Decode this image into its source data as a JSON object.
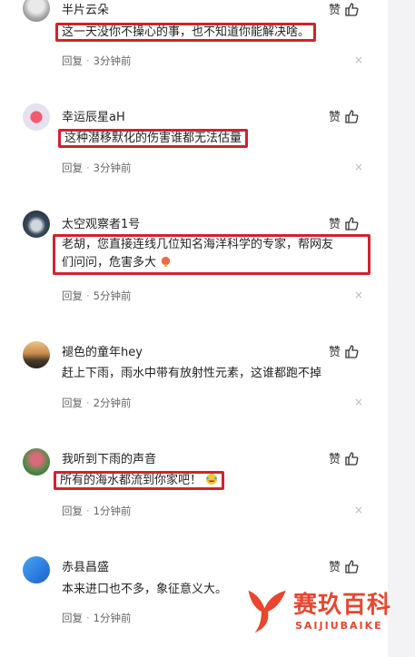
{
  "like_label": "赞",
  "reply_label": "回复",
  "dot": "·",
  "close_glyph": "×",
  "accent": "#d2222d",
  "comments": [
    {
      "user": "半片云朵",
      "text": "这一天没你不操心的事，也不知道你能解决啥。",
      "time": "3分钟前"
    },
    {
      "user": "幸运辰星aH",
      "text": "这种潜移默化的伤害谁都无法估量",
      "time": "3分钟前"
    },
    {
      "user": "太空观察者1号",
      "text_line1": "老胡，您直接连线几位知名海洋科学的专家，帮网友",
      "text_line2": "们问问，危害多大",
      "time": "5分钟前"
    },
    {
      "user": "褪色的童年hey",
      "text": "赶上下雨，雨水中带有放射性元素，这谁都跑不掉",
      "time": "2分钟前"
    },
    {
      "user": "我听到下雨的声音",
      "text": "所有的海水都流到你家吧！",
      "time": "1分钟前"
    },
    {
      "user": "赤县昌盛",
      "text": "本来进口也不多，象征意义大。",
      "time": "1分钟前"
    }
  ],
  "watermark": {
    "name": "赛玖百科",
    "sub": "SAIJIUBAIKE"
  }
}
